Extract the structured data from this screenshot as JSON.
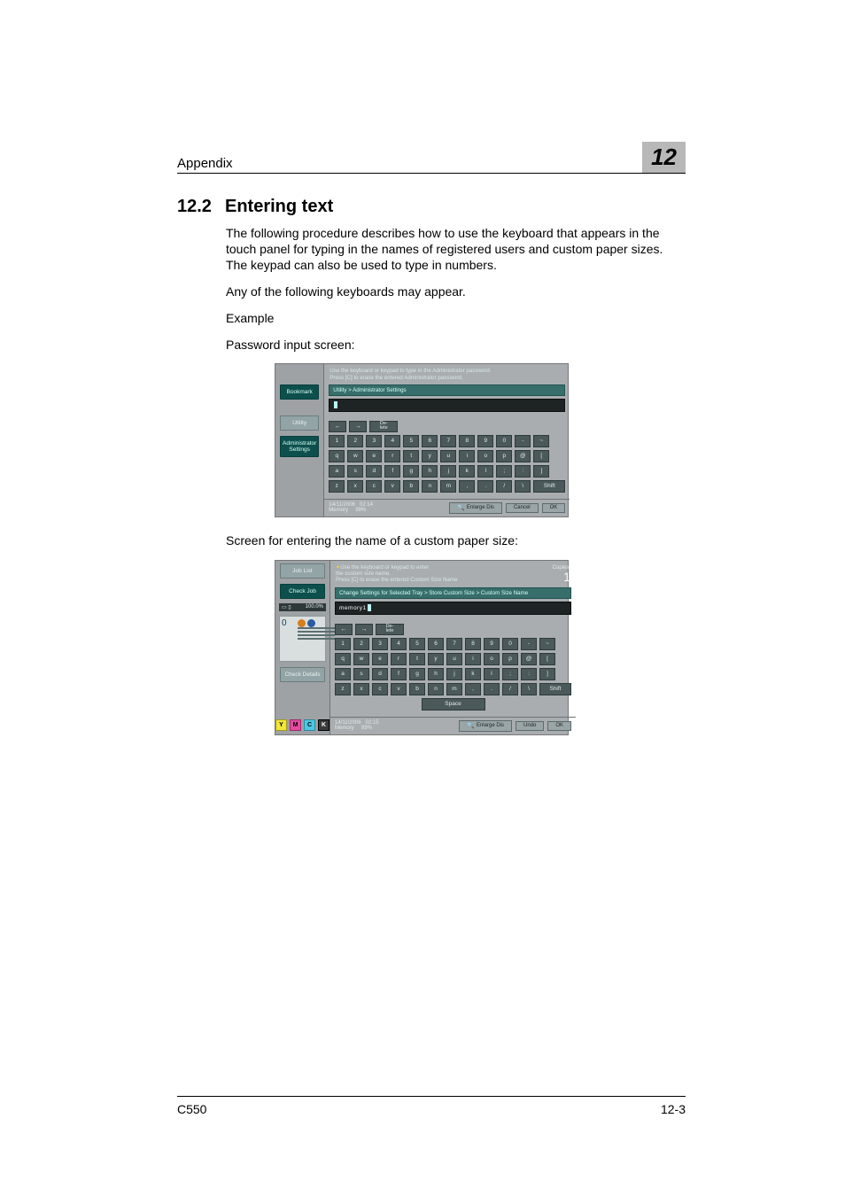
{
  "header": {
    "appendix": "Appendix",
    "chapter_number": "12"
  },
  "section": {
    "number": "12.2",
    "title": "Entering text"
  },
  "paragraphs": {
    "p1": "The following procedure describes how to use the keyboard that appears in the touch panel for typing in the names of registered users and custom paper sizes. The keypad can also be used to type in numbers.",
    "p2": "Any of the following keyboards may appear.",
    "p3": "Example",
    "p4": "Password input screen:",
    "p5": "Screen for entering the name of a custom paper size:"
  },
  "keyboard": {
    "arrows": {
      "left": "←",
      "right": "→"
    },
    "delete_label": "De-\nlete",
    "row1": [
      "1",
      "2",
      "3",
      "4",
      "5",
      "6",
      "7",
      "8",
      "9",
      "0",
      "-",
      "~"
    ],
    "row2": [
      "q",
      "w",
      "e",
      "r",
      "t",
      "y",
      "u",
      "i",
      "o",
      "p",
      "@",
      "["
    ],
    "row3": [
      "a",
      "s",
      "d",
      "f",
      "g",
      "h",
      "j",
      "k",
      "l",
      ";",
      ":",
      "]"
    ],
    "row4": [
      "z",
      "x",
      "c",
      "v",
      "b",
      "n",
      "m",
      ",",
      ".",
      "/",
      "\\"
    ],
    "shift": "Shift",
    "space": "Space"
  },
  "shot1": {
    "instruct": "Use the keyboard or keypad to type in the Administrator password.\nPress [C] to erase the entered Administrator password.",
    "side": {
      "bookmark": "Bookmark",
      "utility": "Utility",
      "admin": "Administrator\nSettings"
    },
    "breadcrumb": "Utility > Administrator Settings",
    "input_value": "",
    "footer": {
      "date": "14/11/2006",
      "time": "02:14",
      "mem_label": "Memory",
      "mem_value": "99%",
      "enlarge": "Enlarge Dis",
      "cancel": "Cancel",
      "ok": "OK"
    }
  },
  "shot2": {
    "instruct": "Use the keyboard or keypad to enter\nthe custom size name.\nPress [C] to erase the entered Custom Size Name",
    "copies": {
      "label": "Copies:",
      "value": "1"
    },
    "side": {
      "joblist": "Job List",
      "checkjob": "Check Job",
      "status_line": "100.0%",
      "zero": "0",
      "checkdetails": "Check Details",
      "toner": {
        "y": "Y",
        "m": "M",
        "c": "C",
        "k": "K"
      }
    },
    "breadcrumb": "Change Settings for Selected Tray > Store Custom Size > Custom Size Name",
    "input_value": "memory1",
    "footer": {
      "date": "14/11/2006",
      "time": "02:15",
      "mem_label": "Memory",
      "mem_value": "99%",
      "enlarge": "Enlarge Dis",
      "undo": "Undo",
      "ok": "OK"
    }
  },
  "footer": {
    "model": "C550",
    "page": "12-3"
  }
}
